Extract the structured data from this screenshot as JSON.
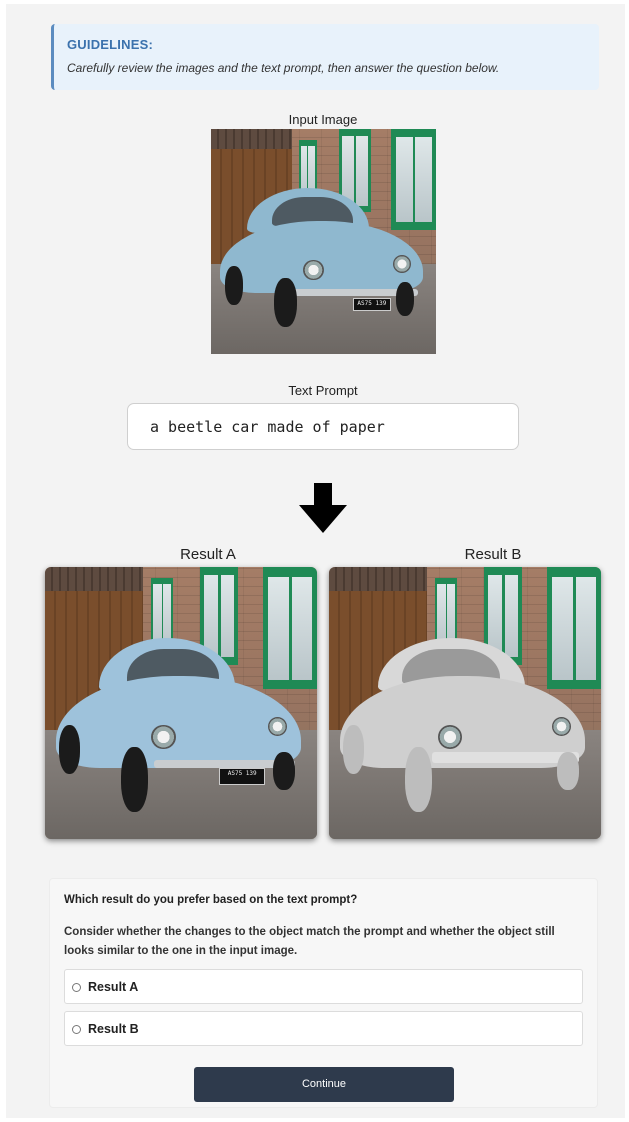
{
  "guidelines": {
    "title": "GUIDELINES:",
    "text": "Carefully review the images and the text prompt, then answer the question below."
  },
  "input_image": {
    "caption": "Input Image",
    "plate": "AS75 139"
  },
  "text_prompt": {
    "caption": "Text Prompt",
    "value": "a beetle car made of paper"
  },
  "results": {
    "a": {
      "caption": "Result A",
      "plate": "AS75 139"
    },
    "b": {
      "caption": "Result B"
    }
  },
  "question": {
    "title": "Which result do you prefer based on the text prompt?",
    "detail": "Consider whether the changes to the object match the prompt and whether the object still looks similar to the one in the input image.",
    "options": [
      {
        "label": "Result A"
      },
      {
        "label": "Result B"
      }
    ],
    "continue_label": "Continue"
  },
  "colors": {
    "guideline_accent": "#3b72ad",
    "button_bg": "#2e3a4c",
    "car_blue": "#8fb8cf",
    "paper_white": "#d8d8d8"
  },
  "icons": {
    "arrow": "down-arrow-icon",
    "radio": "radio-icon"
  }
}
